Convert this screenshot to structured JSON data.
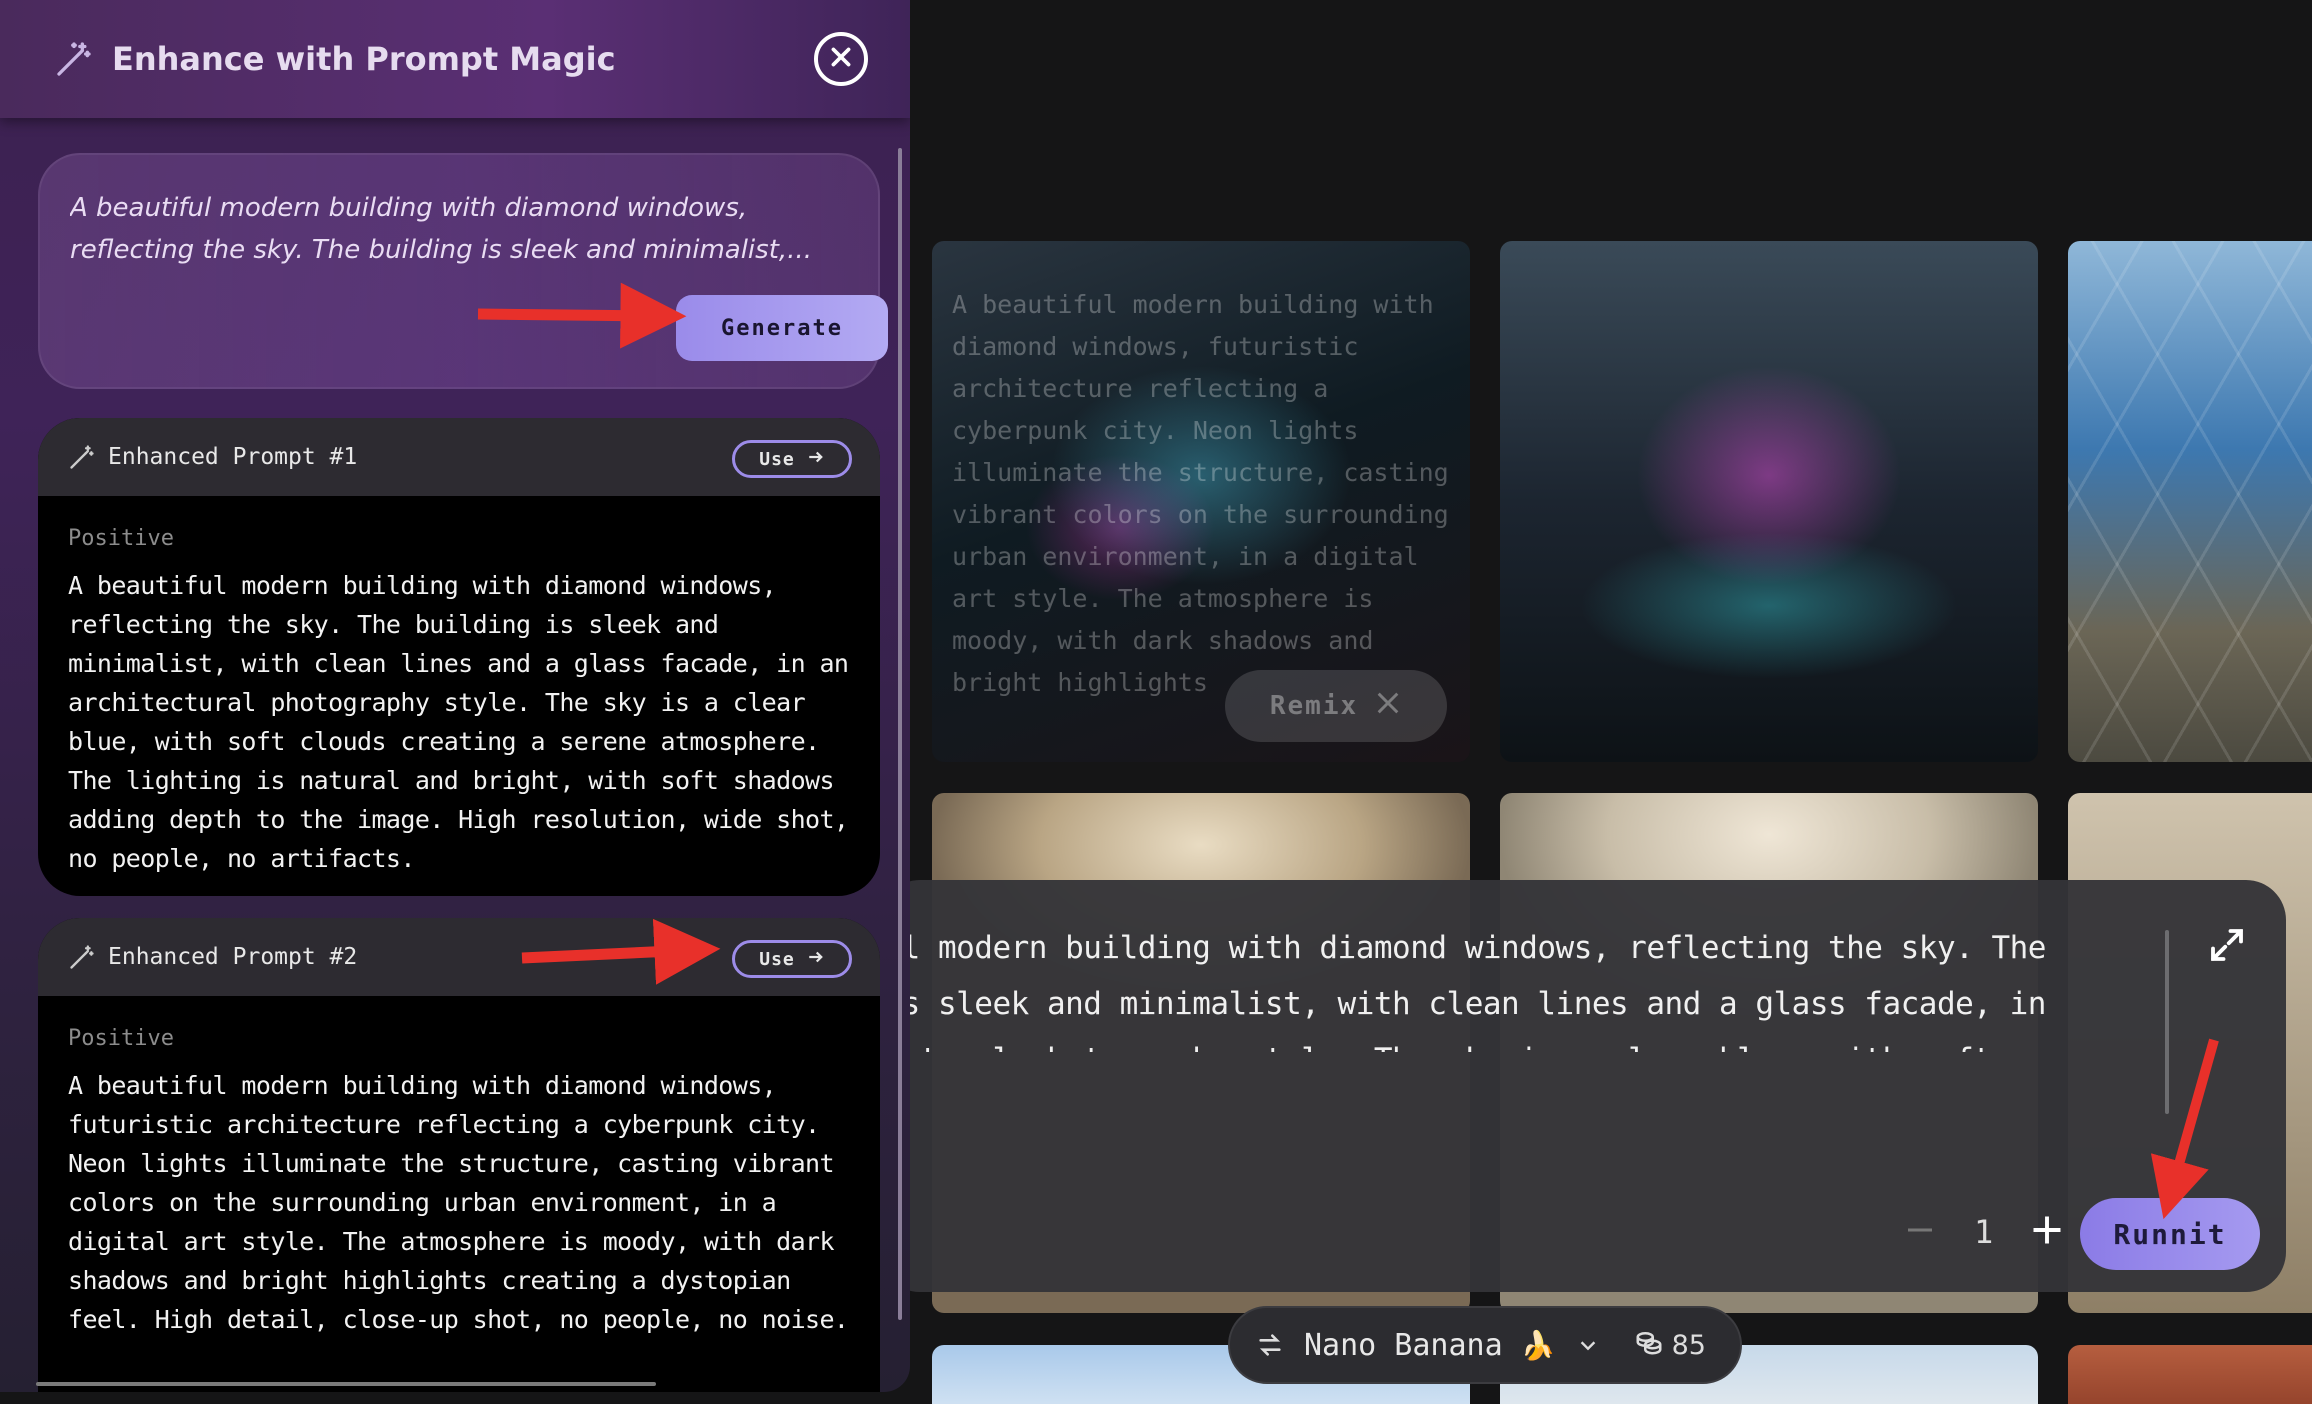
{
  "panel": {
    "title": "Enhance with Prompt Magic",
    "input_text": "A beautiful modern building with diamond windows, reflecting the sky. The building is sleek and minimalist,...",
    "generate_label": "Generate",
    "enhanced": [
      {
        "title": "Enhanced Prompt #1",
        "use_label": "Use",
        "section_label": "Positive",
        "text": "A beautiful modern building with diamond windows, reflecting the sky. The building is sleek and minimalist, with clean lines and a glass facade, in an architectural photography style. The sky is a clear blue, with soft clouds creating a serene atmosphere. The lighting is natural and bright, with soft shadows adding depth to the image. High resolution, wide shot, no people, no artifacts."
      },
      {
        "title": "Enhanced Prompt #2",
        "use_label": "Use",
        "section_label": "Positive",
        "text": "A beautiful modern building with diamond windows, futuristic architecture reflecting a cyberpunk city. Neon lights illuminate the structure, casting vibrant colors on the surrounding urban environment, in a digital art style. The atmosphere is moody, with dark shadows and bright highlights creating a dystopian feel. High detail, close-up shot, no people, no noise."
      }
    ]
  },
  "gallery": {
    "overlay_text": "A beautiful modern building with diamond windows, futuristic architecture reflecting a cyberpunk city. Neon lights illuminate the structure, casting vibrant colors on the surrounding urban environment, in a digital art style. The atmosphere is moody, with dark shadows and bright highlights",
    "remix_label": "Remix"
  },
  "composer": {
    "text": "A beautiful modern building with diamond windows, reflecting the sky. The building is sleek and minimalist, with clean lines and a glass facade, in an architectural photography style. The sky is a clear blue, with soft clouds creating a serene atmosphere. The lighting is natural and bright, with soft shadows adding depth to the image. High resolution, wide shot, no people, no artifacts.",
    "quantity": "1",
    "run_label": "Runnit"
  },
  "model_bar": {
    "model_name": "Nano Banana",
    "model_emoji": "🍌",
    "credits": "85"
  },
  "colors": {
    "accent": "#9d8ce9",
    "annotation_arrow": "#e8302a",
    "panel_bg": "#3c2150"
  },
  "icons": [
    "magic-wand-icon",
    "close-icon",
    "arrow-right-icon",
    "expand-icon",
    "minus-icon",
    "plus-icon",
    "swap-icon",
    "chevron-down-icon",
    "coins-icon"
  ]
}
